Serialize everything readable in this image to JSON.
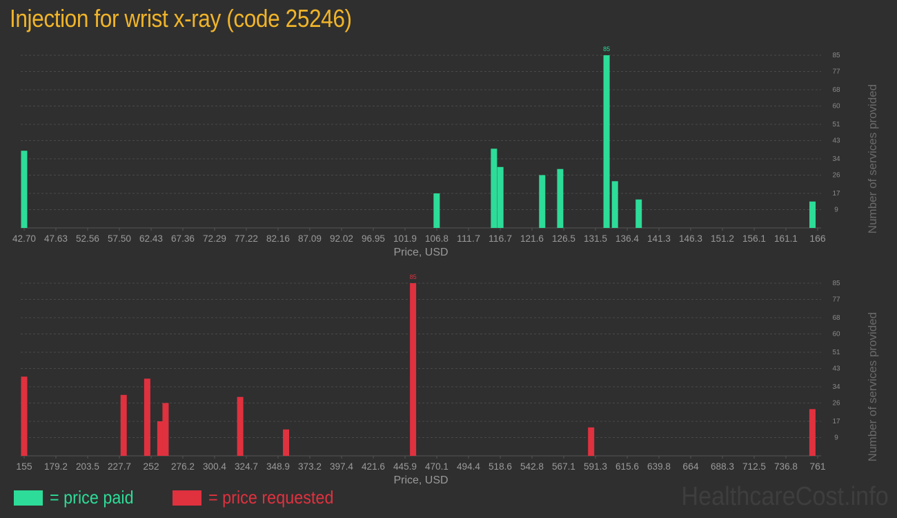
{
  "title": "Injection for wrist x-ray (code 25246)",
  "legend": {
    "paid": {
      "label": "= price paid",
      "color": "#2ddc98"
    },
    "requested": {
      "label": "= price requested",
      "color": "#e0313f"
    }
  },
  "watermark": "HealthcareCost.info",
  "chart_data": [
    {
      "type": "bar",
      "color": "#2ddc98",
      "xlabel": "Price, USD",
      "ylabel": "Number of services provided",
      "x_range": [
        42.7,
        166
      ],
      "ylim": [
        0,
        85
      ],
      "x_ticks": [
        "42.70",
        "47.63",
        "52.56",
        "57.50",
        "62.43",
        "67.36",
        "72.29",
        "77.22",
        "82.16",
        "87.09",
        "92.02",
        "96.95",
        "101.9",
        "106.8",
        "111.7",
        "116.7",
        "121.6",
        "126.5",
        "131.5",
        "136.4",
        "141.3",
        "146.3",
        "151.2",
        "156.1",
        "161.1",
        "166"
      ],
      "y_ticks": [
        9,
        17,
        26,
        34,
        43,
        51,
        60,
        68,
        77,
        85
      ],
      "x": [
        42.7,
        106.8,
        115.7,
        116.7,
        123.2,
        126.0,
        133.2,
        134.5,
        138.2,
        165.2
      ],
      "values": [
        38,
        17,
        39,
        30,
        26,
        29,
        85,
        23,
        14,
        13
      ],
      "max_label": "85"
    },
    {
      "type": "bar",
      "color": "#e0313f",
      "xlabel": "Price, USD",
      "ylabel": "Number of services provided",
      "x_range": [
        155,
        761
      ],
      "ylim": [
        0,
        85
      ],
      "x_ticks": [
        "155",
        "179.2",
        "203.5",
        "227.7",
        "252",
        "276.2",
        "300.4",
        "324.7",
        "348.9",
        "373.2",
        "397.4",
        "421.6",
        "445.9",
        "470.1",
        "494.4",
        "518.6",
        "542.8",
        "567.1",
        "591.3",
        "615.6",
        "639.8",
        "664",
        "688.3",
        "712.5",
        "736.8",
        "761"
      ],
      "y_ticks": [
        9,
        17,
        26,
        34,
        43,
        51,
        60,
        68,
        77,
        85
      ],
      "x": [
        155,
        231,
        249,
        259,
        263,
        320,
        355,
        452,
        588,
        757
      ],
      "values": [
        39,
        30,
        38,
        17,
        26,
        29,
        13,
        85,
        14,
        23
      ],
      "max_label": "85"
    }
  ]
}
